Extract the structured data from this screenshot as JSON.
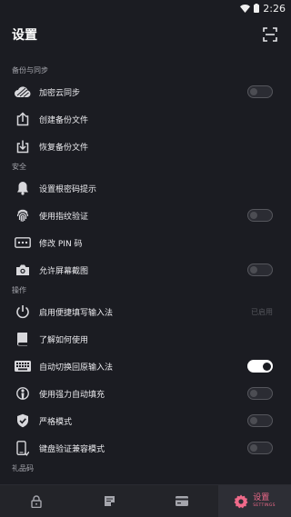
{
  "status_bar": {
    "time": "2:26",
    "icons": [
      "wifi-icon",
      "battery-icon"
    ]
  },
  "header": {
    "title": "设置",
    "action_icon": "scan-icon"
  },
  "sections": [
    {
      "label": "备份与同步",
      "items": [
        {
          "label": "加密云同步",
          "icon": "cloud-icon",
          "control": "toggle",
          "on": false
        },
        {
          "label": "创建备份文件",
          "icon": "upload-icon",
          "control": "none"
        },
        {
          "label": "恢复备份文件",
          "icon": "download-icon",
          "control": "none"
        }
      ]
    },
    {
      "label": "安全",
      "items": [
        {
          "label": "设置根密码提示",
          "icon": "bell-icon",
          "control": "none"
        },
        {
          "label": "使用指纹验证",
          "icon": "fingerprint-icon",
          "control": "toggle",
          "on": false
        },
        {
          "label": "修改 PIN 码",
          "icon": "pin-icon",
          "control": "none"
        },
        {
          "label": "允许屏幕截图",
          "icon": "camera-icon",
          "control": "toggle",
          "on": false
        }
      ]
    },
    {
      "label": "操作",
      "items": [
        {
          "label": "启用便捷填写输入法",
          "icon": "power-icon",
          "control": "text",
          "value": "已启用"
        },
        {
          "label": "了解如何使用",
          "icon": "book-icon",
          "control": "none"
        },
        {
          "label": "自动切换回原输入法",
          "icon": "keyboard-icon",
          "control": "toggle",
          "on": true
        },
        {
          "label": "使用强力自动填充",
          "icon": "autofill-icon",
          "control": "toggle",
          "on": false
        },
        {
          "label": "严格模式",
          "icon": "shield-check-icon",
          "control": "toggle",
          "on": false
        },
        {
          "label": "键盘验证兼容模式",
          "icon": "phone-icon",
          "control": "toggle",
          "on": false
        }
      ]
    },
    {
      "label": "礼品码",
      "items": []
    }
  ],
  "tabbar": {
    "tabs": [
      {
        "icon": "lock-icon",
        "active": false
      },
      {
        "icon": "notes-icon",
        "active": false
      },
      {
        "icon": "card-icon",
        "active": false
      },
      {
        "icon": "settings-gear-icon",
        "active": true,
        "label": "设置",
        "sublabel": "SETTINGS"
      }
    ],
    "accent_color": "#f06a8a"
  },
  "colors": {
    "background": "#1b1c22",
    "text": "#ebebef",
    "section_label": "#a5a6ad",
    "toggle_on": "#ffffff"
  }
}
